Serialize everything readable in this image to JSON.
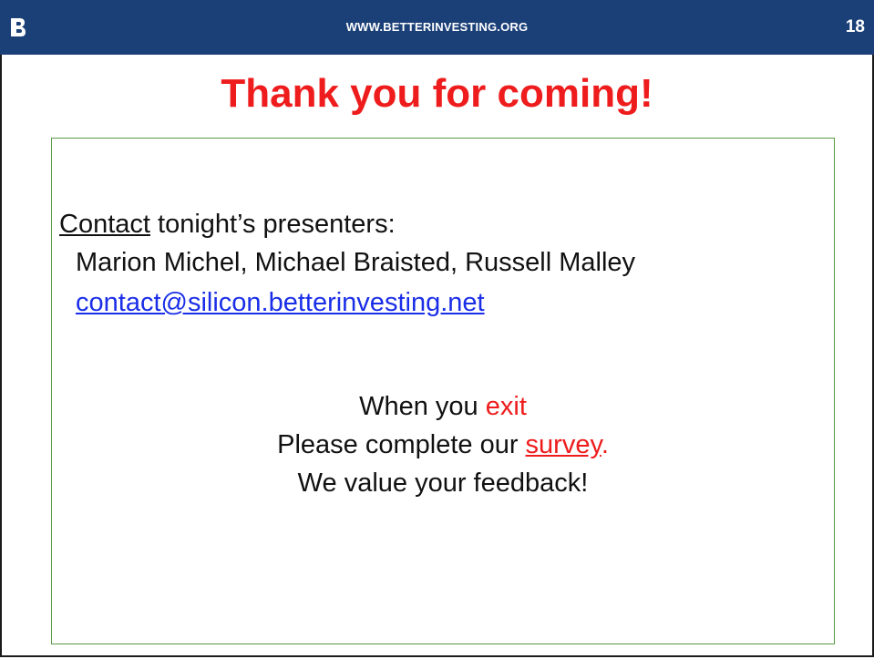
{
  "header": {
    "site_url": "WWW.BETTERINVESTING.ORG",
    "slide_number": "18",
    "logo_icon": "betterinvesting-logo-icon"
  },
  "colors": {
    "header_bg": "#1b4077",
    "title_red": "#ee1c1c",
    "link_blue": "#1a2ee8",
    "box_border_green": "#5a9a45"
  },
  "slide": {
    "title": "Thank you for coming!",
    "contact": {
      "link_word": "Contact",
      "rest": " tonight’s presenters:",
      "presenters": "Marion Michel, Michael Braisted, Russell Malley",
      "email": "contact@silicon.betterinvesting.net"
    },
    "exit_message": {
      "line1_prefix": "When you ",
      "line1_highlight": "exit",
      "line2_prefix": "Please complete our ",
      "line2_link": "survey",
      "line2_suffix": ".",
      "line3": "We value your feedback!"
    }
  }
}
